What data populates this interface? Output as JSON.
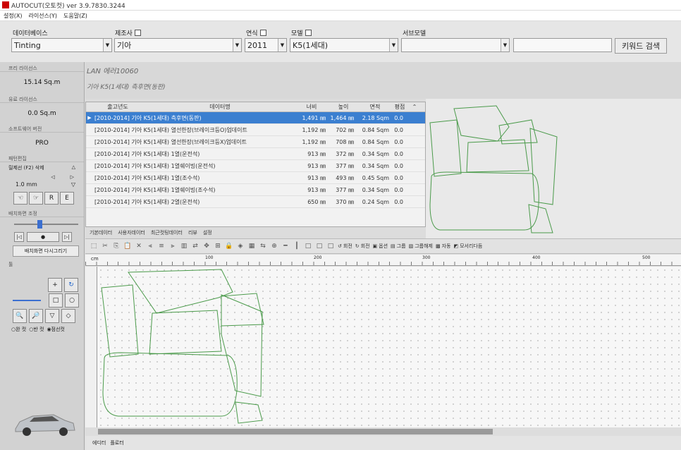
{
  "window": {
    "title": "AUTOCUT(오토컷) ver 3.9.7830.3244"
  },
  "menu": [
    "설정(X)",
    "라이선스(Y)",
    "도움말(Z)"
  ],
  "filters": {
    "database_label": "데이터베이스",
    "database_value": "Tinting",
    "maker_label": "제조사",
    "maker_value": "기아",
    "year_label": "연식",
    "year_value": "2011",
    "model_label": "모델",
    "model_value": "K5(1세대)",
    "submodel_label": "서브모델",
    "submodel_value": "",
    "keyword_value": "",
    "search_button": "키워드 검색"
  },
  "left": {
    "license_head": "프리 라이선스",
    "license_value": "15.14 Sq.m",
    "paid_head": "유료 라이선스",
    "paid_value": "0.0 Sq.m",
    "software_head": "소프트웨어 버전",
    "software_value": "PRO",
    "pattern_head": "패턴편집",
    "outline_label": "릴제선 (F2) 삭제",
    "mm_value": "1.0 mm",
    "btn_r": "R",
    "btn_e": "E",
    "layout_head": "배치화면 조정",
    "redraw_button": "배치화면 다시그리기",
    "tool_head": "툴",
    "radio_full": "완 컷",
    "radio_half": "반 컷",
    "radio_dotted": "점선컷"
  },
  "info": {
    "line1": "LAN 에러10060",
    "line2": "기아 K5(1세대) 측후면(동판)"
  },
  "grid": {
    "headers": [
      "출고년도",
      "데이터명",
      "너비",
      "높이",
      "면적",
      "평점"
    ],
    "rows": [
      {
        "name": "[2010-2014] 기아 K5(1세대) 측후면(동판)",
        "w": "1,491 ㎜",
        "h": "1,464 ㎜",
        "a": "2.18 Sqm",
        "p": "0.0",
        "selected": true
      },
      {
        "name": "[2010-2014] 기아 K5(1세대) 열선한장(브레이크등O)업데이트",
        "w": "1,192 ㎜",
        "h": "702 ㎜",
        "a": "0.84 Sqm",
        "p": "0.0",
        "selected": false
      },
      {
        "name": "[2010-2014] 기아 K5(1세대) 열선한장(브레이크등X)업데이트",
        "w": "1,192 ㎜",
        "h": "708 ㎜",
        "a": "0.84 Sqm",
        "p": "0.0",
        "selected": false
      },
      {
        "name": "[2010-2014] 기아 K5(1세대) 1열(운전석)",
        "w": "913 ㎜",
        "h": "372 ㎜",
        "a": "0.34 Sqm",
        "p": "0.0",
        "selected": false
      },
      {
        "name": "[2010-2014] 기아 K5(1세대) 1열쉐이빙(운전석)",
        "w": "913 ㎜",
        "h": "377 ㎜",
        "a": "0.34 Sqm",
        "p": "0.0",
        "selected": false
      },
      {
        "name": "[2010-2014] 기아 K5(1세대) 1열(조수석)",
        "w": "913 ㎜",
        "h": "493 ㎜",
        "a": "0.45 Sqm",
        "p": "0.0",
        "selected": false
      },
      {
        "name": "[2010-2014] 기아 K5(1세대) 1열쉐이빙(조수석)",
        "w": "913 ㎜",
        "h": "377 ㎜",
        "a": "0.34 Sqm",
        "p": "0.0",
        "selected": false
      },
      {
        "name": "[2010-2014] 기아 K5(1세대) 2열(운전석)",
        "w": "650 ㎜",
        "h": "370 ㎜",
        "a": "0.24 Sqm",
        "p": "0.0",
        "selected": false
      }
    ]
  },
  "tabs": [
    "기본데이터",
    "사용자데이터",
    "최근컷팅데이터",
    "리뷰",
    "설정"
  ],
  "commands": {
    "rotate_ccw": "회전",
    "rotate_cw": "회전",
    "options": "옵션",
    "group": "그룹",
    "ungroup": "그룹해제",
    "align": "자동",
    "corner": "모서리다듬"
  },
  "ruler": {
    "unit": "cm",
    "ticks": [
      "100",
      "200",
      "300",
      "400",
      "500"
    ]
  },
  "bottom_tabs": [
    "에디터",
    "플로터"
  ]
}
